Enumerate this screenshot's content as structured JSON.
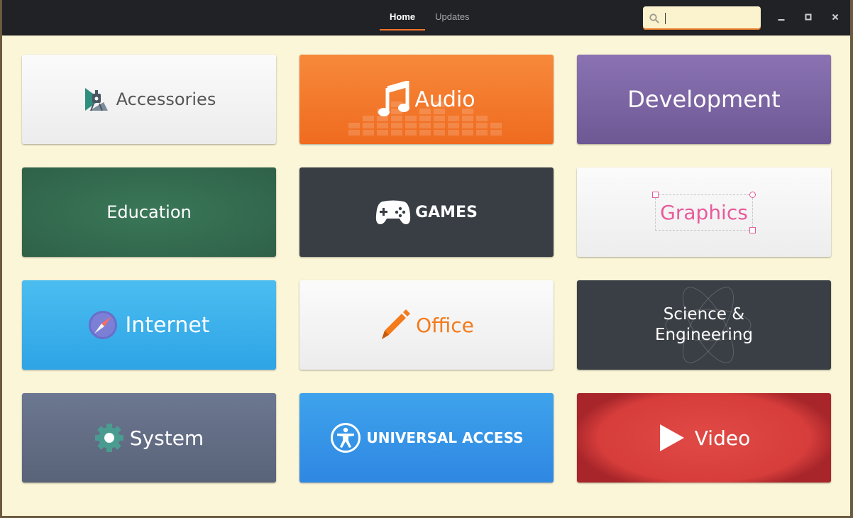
{
  "header": {
    "tabs": [
      {
        "label": "Home",
        "active": true
      },
      {
        "label": "Updates",
        "active": false
      }
    ],
    "search": {
      "value": "",
      "placeholder": "",
      "icon": "search-icon"
    },
    "window_controls": [
      "minimize-icon",
      "maximize-icon",
      "close-icon"
    ],
    "accent_color": "#f37329"
  },
  "categories": [
    {
      "label": "Accessories",
      "icon": "accessories-icon",
      "color": "#f5f5f5"
    },
    {
      "label": "Audio",
      "icon": "music-note-icon",
      "color": "#f37b2d"
    },
    {
      "label": "Development",
      "icon": "",
      "color": "#7e67a6"
    },
    {
      "label": "Education",
      "icon": "",
      "color": "#336b4f"
    },
    {
      "label": "GAMES",
      "icon": "gamepad-icon",
      "color": "#393d44"
    },
    {
      "label": "Graphics",
      "icon": "selection-frame-icon",
      "color": "#f4f4f4"
    },
    {
      "label": "Internet",
      "icon": "compass-icon",
      "color": "#3cb1eb"
    },
    {
      "label": "Office",
      "icon": "pencil-icon",
      "color": "#f4f4f4"
    },
    {
      "label": "Science &",
      "label2": "Engineering",
      "icon": "atom-icon",
      "color": "#3a3f45"
    },
    {
      "label": "System",
      "icon": "gear-icon",
      "color": "#636d85"
    },
    {
      "label": "UNIVERSAL ACCESS",
      "icon": "accessibility-icon",
      "color": "#3595e7"
    },
    {
      "label": "Video",
      "icon": "play-icon",
      "color": "#d63d3b"
    }
  ]
}
